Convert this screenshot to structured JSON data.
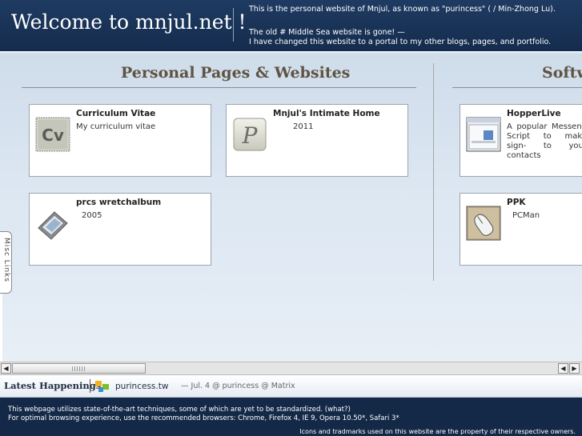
{
  "header": {
    "site_title": "Welcome to mnjul.net !",
    "intro_line1": "This is the personal website of Mnjul, as known as \"purincess\" (   / Min-Zhong Lu).",
    "intro_line2": "The old # Middle Sea website is gone! —",
    "intro_line3": "I have changed this website to a portal to my other blogs, pages, and portfolio."
  },
  "sections": {
    "personal_title": "Personal Pages & Websites",
    "software_title": "Softw"
  },
  "cards": [
    {
      "title": "Curriculum Vitae",
      "desc": "My curriculum vitae",
      "icon": "cv-icon"
    },
    {
      "title": "Mnjul's Intimate Home",
      "desc": "2011",
      "icon": "p-letter-icon"
    },
    {
      "title": "prcs wretchalbum",
      "desc": "2005",
      "icon": "photo-album-icon"
    },
    {
      "title": "HopperLive",
      "desc": "A popular Messeng Script to make sign- to your contacts",
      "icon": "hopperlive-icon"
    },
    {
      "title": "PPK",
      "desc": "PCMan",
      "icon": "mouse-icon"
    }
  ],
  "misc_tab": {
    "label": "Misc Links"
  },
  "happenings": {
    "label": "Latest Happenings",
    "site": "purincess.tw",
    "news": "— Jul. 4 @ purincess @ Matrix"
  },
  "footer": {
    "line1": "This webpage utilizes state-of-the-art techniques, some of which are yet to be standardized. (what?)",
    "line2": "For optimal browsing experience, use the recommended browsers: Chrome, Firefox 4, IE 9, Opera 10.50*, Safari 3*",
    "line3": "Icons and tradmarks used on this website are the property of their respective owners."
  },
  "scrollbar": {
    "left_arrow": "◀",
    "right_arrow": "▶"
  }
}
